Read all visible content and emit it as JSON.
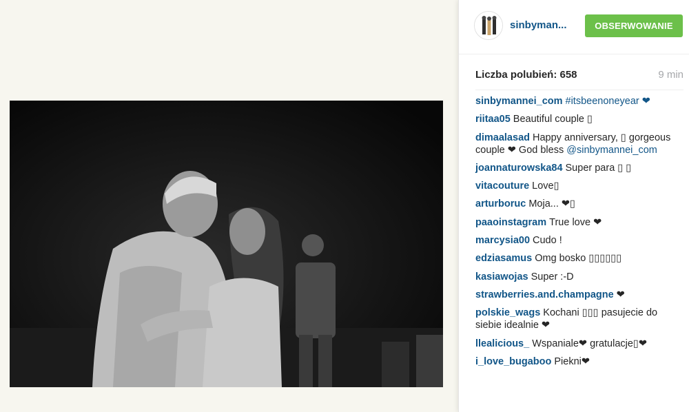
{
  "header": {
    "username": "sinbyman...",
    "follow_label": "OBSERWOWANIE"
  },
  "likes": {
    "text": "Liczba polubień: 658",
    "timestamp": "9 min"
  },
  "comments": [
    {
      "user": "sinbymannei_com",
      "text": "#itsbeenoneyear ❤"
    },
    {
      "user": "riitaa05",
      "text": "Beautiful couple ▯"
    },
    {
      "user": "dimaalasad",
      "text": "Happy anniversary, ▯ gorgeous couple ❤ God bless",
      "mention": "@sinbymannei_com"
    },
    {
      "user": "joannaturowska84",
      "text": "Super para ▯ ▯"
    },
    {
      "user": "vitacouture",
      "text": "Love▯"
    },
    {
      "user": "arturboruc",
      "text": "Moja... ❤▯"
    },
    {
      "user": "paaoinstagram",
      "text": "True love ❤"
    },
    {
      "user": "marcysia00",
      "text": "Cudo !"
    },
    {
      "user": "edziasamus",
      "text": "Omg bosko ▯▯▯▯▯▯"
    },
    {
      "user": "kasiawojas",
      "text": "Super :-D"
    },
    {
      "user": "strawberries.and.champagne",
      "text": "❤"
    },
    {
      "user": "polskie_wags",
      "text": "Kochani ▯▯▯ pasujecie do siebie idealnie ❤"
    },
    {
      "user": "llealicious_",
      "text": "Wspaniale❤ gratulacje▯❤"
    },
    {
      "user": "i_love_bugaboo",
      "text": "Piekni❤"
    }
  ],
  "colors": {
    "follow_button": "#6cc04a",
    "username_link": "#125688",
    "page_background": "#f7f6ef"
  }
}
